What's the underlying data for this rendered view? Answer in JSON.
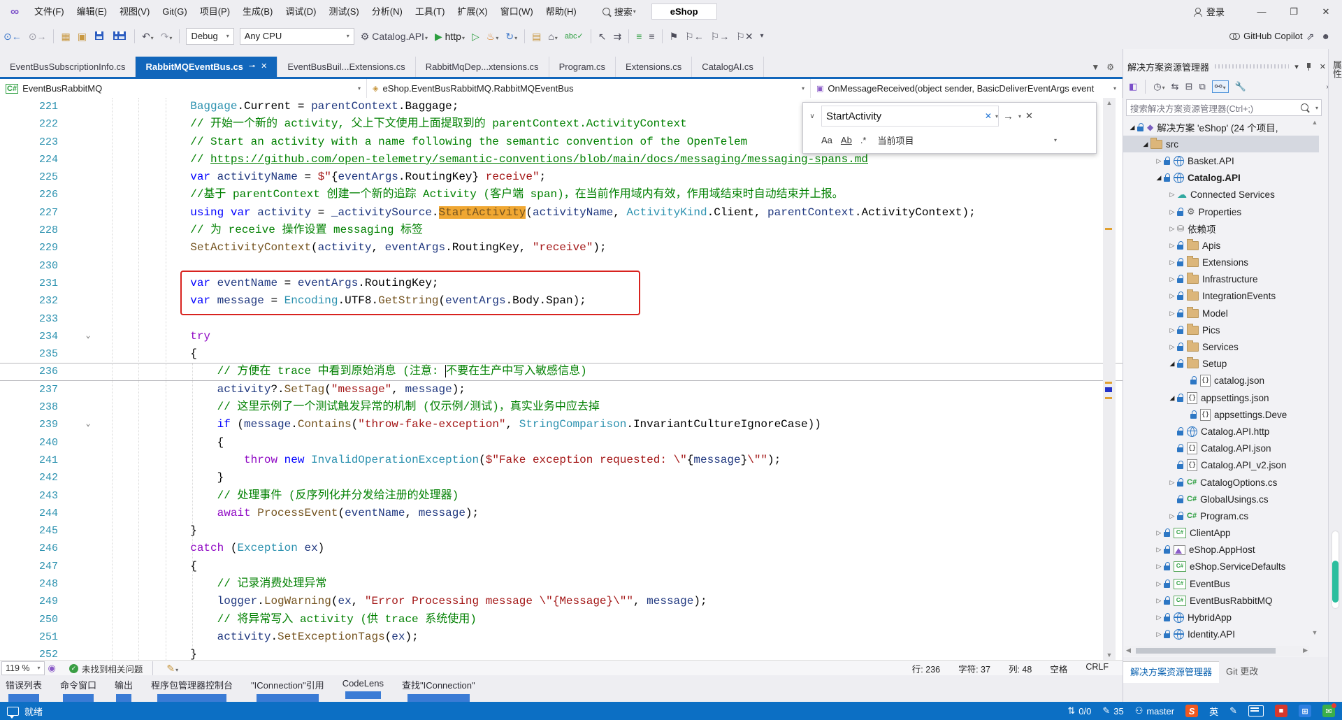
{
  "window": {
    "logo": "∞",
    "menus": [
      "文件(F)",
      "编辑(E)",
      "视图(V)",
      "Git(G)",
      "项目(P)",
      "生成(B)",
      "调试(D)",
      "测试(S)",
      "分析(N)",
      "工具(T)",
      "扩展(X)",
      "窗口(W)",
      "帮助(H)"
    ],
    "search_label": "搜索",
    "search_box_value": "eShop",
    "sign_in": "登录",
    "minimize": "—",
    "restore": "❐",
    "close": "✕"
  },
  "toolbar": {
    "debug_config": "Debug",
    "platform": "Any CPU",
    "startup_project": "Catalog.API",
    "run_profile": "http",
    "copilot_label": "GitHub Copilot"
  },
  "tabs": [
    {
      "label": "EventBusSubscriptionInfo.cs",
      "active": false
    },
    {
      "label": "RabbitMQEventBus.cs",
      "active": true
    },
    {
      "label": "EventBusBuil...Extensions.cs",
      "active": false
    },
    {
      "label": "RabbitMqDep...xtensions.cs",
      "active": false
    },
    {
      "label": "Program.cs",
      "active": false
    },
    {
      "label": "Extensions.cs",
      "active": false
    },
    {
      "label": "CatalogAI.cs",
      "active": false
    }
  ],
  "navbar": {
    "project": "EventBusRabbitMQ",
    "type": "eShop.EventBusRabbitMQ.RabbitMQEventBus",
    "member": "OnMessageReceived(object sender, BasicDeliverEventArgs event"
  },
  "find": {
    "query": "StartActivity",
    "clear": "✕",
    "next": "→",
    "close": "✕",
    "match_case": "Aa",
    "whole_word": "Ab",
    "regex": ".*",
    "scope": "当前项目"
  },
  "code": {
    "lines": [
      {
        "n": 221,
        "t": [
          [
            "p",
            "            "
          ],
          [
            "y",
            "Baggage"
          ],
          [
            "p",
            ".Current = "
          ],
          [
            "v",
            "parentContext"
          ],
          [
            "p",
            ".Baggage;"
          ]
        ]
      },
      {
        "n": 222,
        "t": [
          [
            "c",
            "            // 开始一个新的 activity, 父上下文使用上面提取到的 parentContext.ActivityContext"
          ]
        ]
      },
      {
        "n": 223,
        "t": [
          [
            "c",
            "            // Start an activity with a name following the semantic convention of the OpenTelem"
          ]
        ]
      },
      {
        "n": 224,
        "t": [
          [
            "c",
            "            // "
          ],
          [
            "L",
            "https://github.com/open-telemetry/semantic-conventions/blob/main/docs/messaging/messaging-spans.md"
          ]
        ]
      },
      {
        "n": 225,
        "t": [
          [
            "k",
            "            var"
          ],
          [
            "p",
            " "
          ],
          [
            "v",
            "activityName"
          ],
          [
            "p",
            " = "
          ],
          [
            "s",
            "$\""
          ],
          [
            "p",
            "{"
          ],
          [
            "v",
            "eventArgs"
          ],
          [
            "p",
            ".RoutingKey}"
          ],
          [
            "s",
            " receive\""
          ],
          [
            "p",
            ";"
          ]
        ]
      },
      {
        "n": 226,
        "t": [
          [
            "c",
            "            //基于 parentContext 创建一个新的追踪 Activity (客户端 span)，在当前作用域内有效，作用域结束时自动结束并上报。"
          ]
        ]
      },
      {
        "n": 227,
        "t": [
          [
            "k",
            "            using"
          ],
          [
            "p",
            " "
          ],
          [
            "k",
            "var"
          ],
          [
            "p",
            " "
          ],
          [
            "v",
            "activity"
          ],
          [
            "p",
            " = "
          ],
          [
            "v",
            "_activitySource"
          ],
          [
            "p",
            "."
          ],
          [
            "H",
            "StartActivity"
          ],
          [
            "p",
            "("
          ],
          [
            "v",
            "activityName"
          ],
          [
            "p",
            ", "
          ],
          [
            "y",
            "ActivityKind"
          ],
          [
            "p",
            ".Client, "
          ],
          [
            "v",
            "parentContext"
          ],
          [
            "p",
            ".ActivityContext);"
          ]
        ]
      },
      {
        "n": 228,
        "t": [
          [
            "c",
            "            // 为 receive 操作设置 messaging 标签"
          ]
        ]
      },
      {
        "n": 229,
        "t": [
          [
            "p",
            "            "
          ],
          [
            "m",
            "SetActivityContext"
          ],
          [
            "p",
            "("
          ],
          [
            "v",
            "activity"
          ],
          [
            "p",
            ", "
          ],
          [
            "v",
            "eventArgs"
          ],
          [
            "p",
            ".RoutingKey, "
          ],
          [
            "s",
            "\"receive\""
          ],
          [
            "p",
            ");"
          ]
        ]
      },
      {
        "n": 230,
        "t": []
      },
      {
        "n": 231,
        "t": [
          [
            "k",
            "            var"
          ],
          [
            "p",
            " "
          ],
          [
            "v",
            "eventName"
          ],
          [
            "p",
            " = "
          ],
          [
            "v",
            "eventArgs"
          ],
          [
            "p",
            ".RoutingKey;"
          ]
        ]
      },
      {
        "n": 232,
        "t": [
          [
            "k",
            "            var"
          ],
          [
            "p",
            " "
          ],
          [
            "v",
            "message"
          ],
          [
            "p",
            " = "
          ],
          [
            "y",
            "Encoding"
          ],
          [
            "p",
            ".UTF8."
          ],
          [
            "m",
            "GetString"
          ],
          [
            "p",
            "("
          ],
          [
            "v",
            "eventArgs"
          ],
          [
            "p",
            ".Body.Span);"
          ]
        ]
      },
      {
        "n": 233,
        "t": []
      },
      {
        "n": 234,
        "chev": true,
        "t": [
          [
            "q",
            "            try"
          ]
        ]
      },
      {
        "n": 235,
        "t": [
          [
            "p",
            "            {"
          ]
        ]
      },
      {
        "n": 236,
        "cur": true,
        "t": [
          [
            "c",
            "                // 方便在 trace 中看到原始消息 (注意: "
          ],
          [
            "caret",
            ""
          ],
          [
            "c",
            "不要在生产中写入敏感信息)"
          ]
        ]
      },
      {
        "n": 237,
        "t": [
          [
            "p",
            "                "
          ],
          [
            "v",
            "activity"
          ],
          [
            "p",
            "?."
          ],
          [
            "m",
            "SetTag"
          ],
          [
            "p",
            "("
          ],
          [
            "s",
            "\"message\""
          ],
          [
            "p",
            ", "
          ],
          [
            "v",
            "message"
          ],
          [
            "p",
            ");"
          ]
        ]
      },
      {
        "n": 238,
        "t": [
          [
            "c",
            "                // 这里示例了一个测试触发异常的机制 (仅示例/测试)，真实业务中应去掉"
          ]
        ]
      },
      {
        "n": 239,
        "chev": true,
        "t": [
          [
            "p",
            "                "
          ],
          [
            "k",
            "if"
          ],
          [
            "p",
            " ("
          ],
          [
            "v",
            "message"
          ],
          [
            "p",
            "."
          ],
          [
            "m",
            "Contains"
          ],
          [
            "p",
            "("
          ],
          [
            "s",
            "\"throw-fake-exception\""
          ],
          [
            "p",
            ", "
          ],
          [
            "y",
            "StringComparison"
          ],
          [
            "p",
            ".InvariantCultureIgnoreCase))"
          ]
        ]
      },
      {
        "n": 240,
        "t": [
          [
            "p",
            "                {"
          ]
        ]
      },
      {
        "n": 241,
        "t": [
          [
            "p",
            "                    "
          ],
          [
            "q",
            "throw"
          ],
          [
            "p",
            " "
          ],
          [
            "k",
            "new"
          ],
          [
            "p",
            " "
          ],
          [
            "y",
            "InvalidOperationException"
          ],
          [
            "p",
            "("
          ],
          [
            "s",
            "$\"Fake exception requested: \\\""
          ],
          [
            "p",
            "{"
          ],
          [
            "v",
            "message"
          ],
          [
            "p",
            "}"
          ],
          [
            "s",
            "\\\"\""
          ],
          [
            "p",
            ");"
          ]
        ]
      },
      {
        "n": 242,
        "t": [
          [
            "p",
            "                }"
          ]
        ]
      },
      {
        "n": 243,
        "t": [
          [
            "c",
            "                // 处理事件 (反序列化并分发给注册的处理器)"
          ]
        ]
      },
      {
        "n": 244,
        "t": [
          [
            "p",
            "                "
          ],
          [
            "q",
            "await"
          ],
          [
            "p",
            " "
          ],
          [
            "m",
            "ProcessEvent"
          ],
          [
            "p",
            "("
          ],
          [
            "v",
            "eventName"
          ],
          [
            "p",
            ", "
          ],
          [
            "v",
            "message"
          ],
          [
            "p",
            ");"
          ]
        ]
      },
      {
        "n": 245,
        "t": [
          [
            "p",
            "            }"
          ]
        ]
      },
      {
        "n": 246,
        "t": [
          [
            "q",
            "            catch"
          ],
          [
            "p",
            " ("
          ],
          [
            "y",
            "Exception"
          ],
          [
            "p",
            " "
          ],
          [
            "v",
            "ex"
          ],
          [
            "p",
            ")"
          ]
        ]
      },
      {
        "n": 247,
        "t": [
          [
            "p",
            "            {"
          ]
        ]
      },
      {
        "n": 248,
        "t": [
          [
            "c",
            "                // 记录消费处理异常"
          ]
        ]
      },
      {
        "n": 249,
        "t": [
          [
            "p",
            "                "
          ],
          [
            "v",
            "logger"
          ],
          [
            "p",
            "."
          ],
          [
            "m",
            "LogWarning"
          ],
          [
            "p",
            "("
          ],
          [
            "v",
            "ex"
          ],
          [
            "p",
            ", "
          ],
          [
            "s",
            "\"Error Processing message \\\"{Message}\\\"\""
          ],
          [
            "p",
            ", "
          ],
          [
            "v",
            "message"
          ],
          [
            "p",
            ");"
          ]
        ]
      },
      {
        "n": 250,
        "t": [
          [
            "c",
            "                // 将异常写入 activity (供 trace 系统使用)"
          ]
        ]
      },
      {
        "n": 251,
        "t": [
          [
            "p",
            "                "
          ],
          [
            "v",
            "activity"
          ],
          [
            "p",
            "."
          ],
          [
            "m",
            "SetExceptionTags"
          ],
          [
            "p",
            "("
          ],
          [
            "v",
            "ex"
          ],
          [
            "p",
            ");"
          ]
        ]
      },
      {
        "n": 252,
        "t": [
          [
            "p",
            "            }"
          ]
        ]
      }
    ]
  },
  "editor_status": {
    "zoom": "119 %",
    "health": "未找到相关问题",
    "line": "行: 236",
    "char": "字符: 37",
    "col": "列: 48",
    "space": "空格",
    "eol": "CRLF"
  },
  "bottom_tabs": [
    "错误列表",
    "命令窗口",
    "输出",
    "程序包管理器控制台",
    "\"IConnection\"引用",
    "CodeLens",
    "查找\"IConnection\""
  ],
  "solution_explorer": {
    "title": "解决方案资源管理器",
    "search_placeholder": "搜索解决方案资源管理器(Ctrl+;)",
    "tree": [
      {
        "d": 0,
        "exp": "open",
        "lock": true,
        "icon": "sln",
        "label": "解决方案 'eShop' (24 个项目,"
      },
      {
        "d": 1,
        "exp": "open",
        "icon": "folder",
        "label": "src",
        "selected": true
      },
      {
        "d": 2,
        "exp": "closed",
        "lock": true,
        "icon": "web",
        "label": "Basket.API"
      },
      {
        "d": 2,
        "exp": "open",
        "lock": true,
        "icon": "web",
        "label": "Catalog.API",
        "bold": true
      },
      {
        "d": 3,
        "exp": "closed",
        "icon": "cloud",
        "label": "Connected Services"
      },
      {
        "d": 3,
        "exp": "closed",
        "lock": true,
        "icon": "props",
        "label": "Properties"
      },
      {
        "d": 3,
        "exp": "closed",
        "icon": "deps",
        "label": "依赖项"
      },
      {
        "d": 3,
        "exp": "closed",
        "lock": true,
        "icon": "folder",
        "label": "Apis"
      },
      {
        "d": 3,
        "exp": "closed",
        "lock": true,
        "icon": "folder",
        "label": "Extensions"
      },
      {
        "d": 3,
        "exp": "closed",
        "lock": true,
        "icon": "folder",
        "label": "Infrastructure"
      },
      {
        "d": 3,
        "exp": "closed",
        "lock": true,
        "icon": "folder",
        "label": "IntegrationEvents"
      },
      {
        "d": 3,
        "exp": "closed",
        "lock": true,
        "icon": "folder",
        "label": "Model"
      },
      {
        "d": 3,
        "exp": "closed",
        "lock": true,
        "icon": "folder",
        "label": "Pics"
      },
      {
        "d": 3,
        "exp": "closed",
        "lock": true,
        "icon": "folder",
        "label": "Services"
      },
      {
        "d": 3,
        "exp": "open",
        "lock": true,
        "icon": "folder",
        "label": "Setup"
      },
      {
        "d": 4,
        "lock": true,
        "icon": "json",
        "label": "catalog.json"
      },
      {
        "d": 3,
        "exp": "open",
        "lock": true,
        "icon": "json",
        "label": "appsettings.json"
      },
      {
        "d": 4,
        "lock": true,
        "icon": "json",
        "label": "appsettings.Deve"
      },
      {
        "d": 3,
        "lock": true,
        "icon": "web",
        "label": "Catalog.API.http"
      },
      {
        "d": 3,
        "lock": true,
        "icon": "json",
        "label": "Catalog.API.json"
      },
      {
        "d": 3,
        "lock": true,
        "icon": "json",
        "label": "Catalog.API_v2.json"
      },
      {
        "d": 3,
        "exp": "closed",
        "lock": true,
        "icon": "cs",
        "label": "CatalogOptions.cs"
      },
      {
        "d": 3,
        "lock": true,
        "icon": "cs",
        "label": "GlobalUsings.cs"
      },
      {
        "d": 3,
        "exp": "closed",
        "lock": true,
        "icon": "cs",
        "label": "Program.cs"
      },
      {
        "d": 2,
        "exp": "closed",
        "lock": true,
        "icon": "csproj",
        "label": "ClientApp"
      },
      {
        "d": 2,
        "exp": "closed",
        "lock": true,
        "icon": "apphost",
        "label": "eShop.AppHost"
      },
      {
        "d": 2,
        "exp": "closed",
        "lock": true,
        "icon": "csproj",
        "label": "eShop.ServiceDefaults"
      },
      {
        "d": 2,
        "exp": "closed",
        "lock": true,
        "icon": "csproj",
        "label": "EventBus"
      },
      {
        "d": 2,
        "exp": "closed",
        "lock": true,
        "icon": "csproj",
        "label": "EventBusRabbitMQ"
      },
      {
        "d": 2,
        "exp": "closed",
        "lock": true,
        "icon": "web",
        "label": "HybridApp"
      },
      {
        "d": 2,
        "exp": "closed",
        "lock": true,
        "icon": "web",
        "label": "Identity.API"
      }
    ],
    "dock_tabs": [
      {
        "label": "解决方案资源管理器",
        "active": true
      },
      {
        "label": "Git 更改",
        "active": false
      }
    ],
    "properties_tab": "属性"
  },
  "status_bar": {
    "ready": "就绪",
    "sync": "0/0",
    "pending_edits": "35",
    "branch": "master",
    "ime_logo": "S",
    "ime_lang": "英"
  }
}
